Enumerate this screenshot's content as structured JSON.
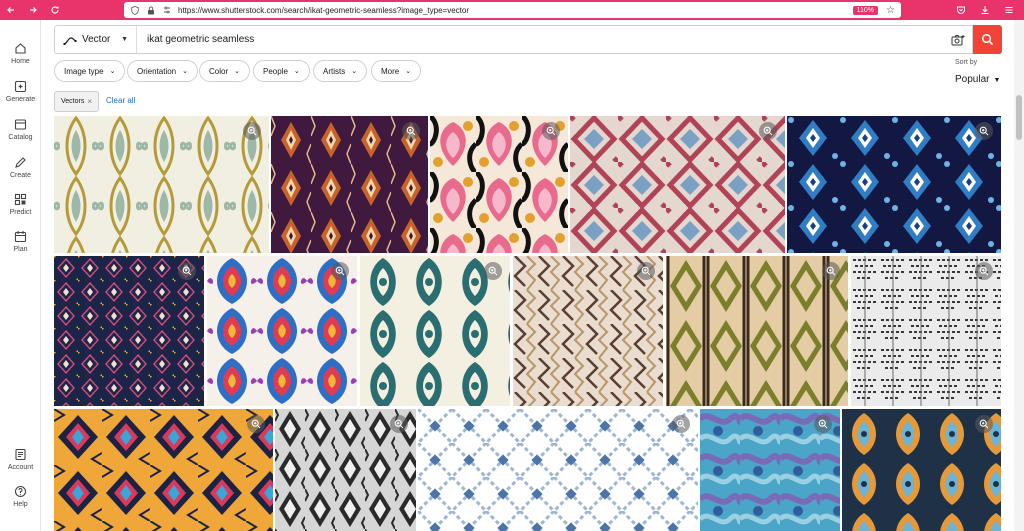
{
  "browser": {
    "url": "https://www.shutterstock.com/search/ikat-geometric-seamless?image_type=vector",
    "zoom": "110%"
  },
  "rail": {
    "items": [
      {
        "label": "Home",
        "icon": "home-icon"
      },
      {
        "label": "Generate",
        "icon": "generate-icon"
      },
      {
        "label": "Catalog",
        "icon": "catalog-icon"
      },
      {
        "label": "Create",
        "icon": "create-icon"
      },
      {
        "label": "Predict",
        "icon": "predict-icon"
      },
      {
        "label": "Plan",
        "icon": "plan-icon"
      },
      {
        "label": "Account",
        "icon": "account-icon"
      },
      {
        "label": "Help",
        "icon": "help-icon"
      }
    ]
  },
  "search": {
    "type_label": "Vector",
    "query": "ikat geometric seamless"
  },
  "filters": {
    "pills": [
      "Image type",
      "Orientation",
      "Color",
      "People",
      "Artists",
      "More"
    ]
  },
  "sort": {
    "label": "Sort by",
    "value": "Popular"
  },
  "active_filters": {
    "chip": "Vectors",
    "clear_label": "Clear all"
  },
  "colors": {
    "accent": "#f24436",
    "browser": "#e8336b",
    "link": "#1f6fd6"
  },
  "grid": {
    "rows": [
      [
        "ikat-olive-cream",
        "ikat-purple-orange",
        "ikat-pink-floral",
        "ikat-red-beige",
        "ikat-navy-blue"
      ],
      [
        "ikat-navy-dots",
        "ikat-red-blue-bold",
        "ikat-teal-cream",
        "ikat-brown-stripes",
        "ikat-olive-diamond",
        "ikat-gray-brush"
      ],
      [
        "ikat-orange-tribal",
        "ikat-black-white",
        "ikat-lattice-blue",
        "ikat-blue-camo",
        "ikat-orange-blue"
      ]
    ]
  }
}
